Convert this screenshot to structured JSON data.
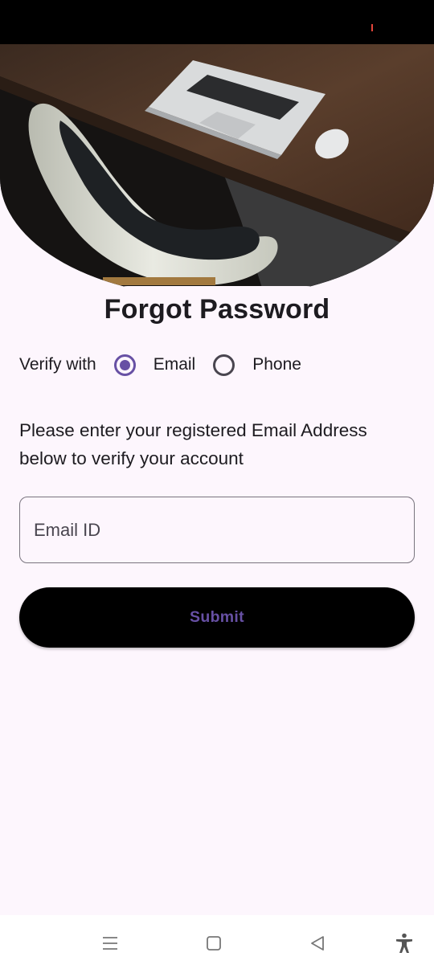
{
  "status_bar": {
    "indicator_color": "#e3453a"
  },
  "hero": {
    "image_alt": "laptop on wooden desk with white chair"
  },
  "page": {
    "title": "Forgot Password"
  },
  "verify": {
    "label": "Verify with",
    "options": [
      {
        "label": "Email",
        "selected": true
      },
      {
        "label": "Phone",
        "selected": false
      }
    ]
  },
  "instructions": "Please enter your registered Email Address below to verify your account",
  "email_field": {
    "placeholder": "Email ID",
    "value": ""
  },
  "submit": {
    "label": "Submit"
  },
  "nav_bar": {
    "icons": [
      "menu-icon",
      "home-square-icon",
      "back-triangle-icon",
      "accessibility-icon"
    ]
  },
  "colors": {
    "accent": "#6750a4",
    "background": "#fdf6fd",
    "button_bg": "#000000",
    "text": "#1d1b20"
  }
}
